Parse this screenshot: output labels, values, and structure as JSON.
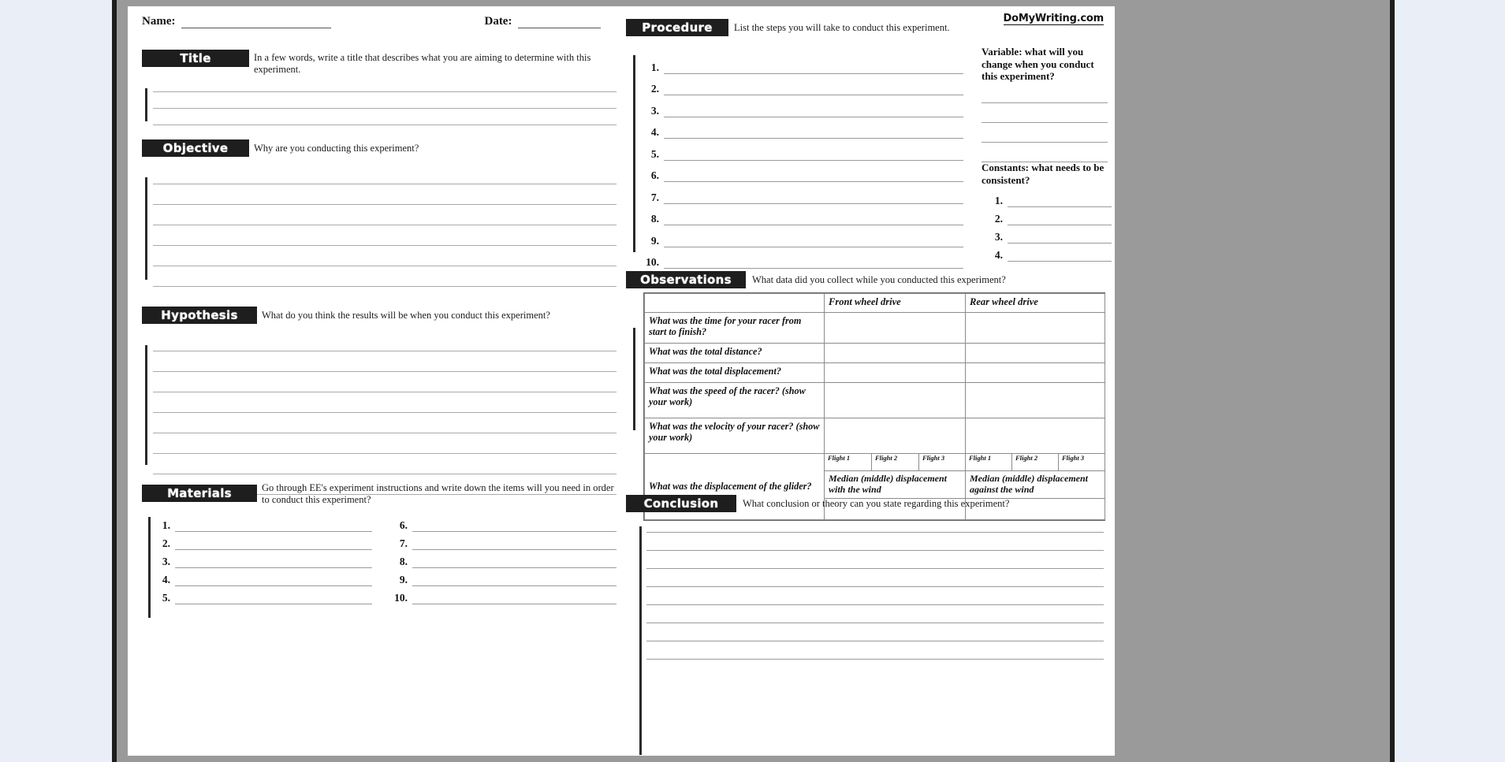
{
  "document": {
    "logo": "DoMyWriting.com",
    "header": {
      "name_label": "Name:",
      "date_label": "Date:"
    }
  },
  "left_page": {
    "sections": [
      {
        "banner": "Title",
        "prompt": "In a few words, write a title that describes what you are aiming to determine with this experiment.",
        "line_count": 3
      },
      {
        "banner": "Objective",
        "prompt": "Why are you conducting this experiment?",
        "line_count": 6
      },
      {
        "banner": "Hypothesis",
        "prompt": "What do you think the results will be when you conduct this experiment?",
        "line_count": 8
      },
      {
        "banner": "Materials",
        "prompt": "Go through EE's experiment instructions and write down the items will you need in order to conduct this experiment?",
        "line_count": 0
      }
    ],
    "materials_list_left": [
      "1.",
      "2.",
      "3.",
      "4.",
      "5."
    ],
    "materials_list_right": [
      "6.",
      "7.",
      "8.",
      "9.",
      "10."
    ]
  },
  "right_page": {
    "procedure": {
      "banner": "Procedure",
      "prompt": "List the steps you will take to conduct this experiment.",
      "items": [
        "1.",
        "2.",
        "3.",
        "4.",
        "5.",
        "6.",
        "7.",
        "8.",
        "9.",
        "10."
      ]
    },
    "variable": {
      "heading": "Variable: what will you change when you conduct this experiment?",
      "line_count": 4
    },
    "constants": {
      "heading": "Constants: what needs to be consistent?",
      "items": [
        "1.",
        "2.",
        "3.",
        "4."
      ]
    },
    "observations": {
      "banner": "Observations",
      "prompt": "What data did you collect while you conducted this experiment?",
      "column_headers": [
        "",
        "Front wheel drive",
        "Rear wheel drive"
      ],
      "rows": [
        "What was the time for your racer from start to finish?",
        "What was the total distance?",
        "What was the total displacement?",
        "What was the speed of the racer? (show your work)",
        "What was the velocity of your racer? (show your work)",
        "What was the displacement of the glider?"
      ],
      "flight_headers": [
        "Flight 1",
        "Flight 2",
        "Flight 3",
        "Flight 1",
        "Flight 2",
        "Flight 3"
      ],
      "median_with_wind": "Median (middle) displacement with the wind",
      "median_against_wind": "Median (middle) displacement against the wind"
    },
    "conclusion": {
      "banner": "Conclusion",
      "prompt": "What conclusion or theory can you state regarding this experiment?",
      "line_count": 8
    }
  },
  "colors": {
    "banner_bg": "#1e1e1e",
    "page_bg": "#ffffff",
    "surround": "#9a9a9a",
    "viewer_bg": "#e9eef7",
    "rule": "#9b9b9b"
  }
}
